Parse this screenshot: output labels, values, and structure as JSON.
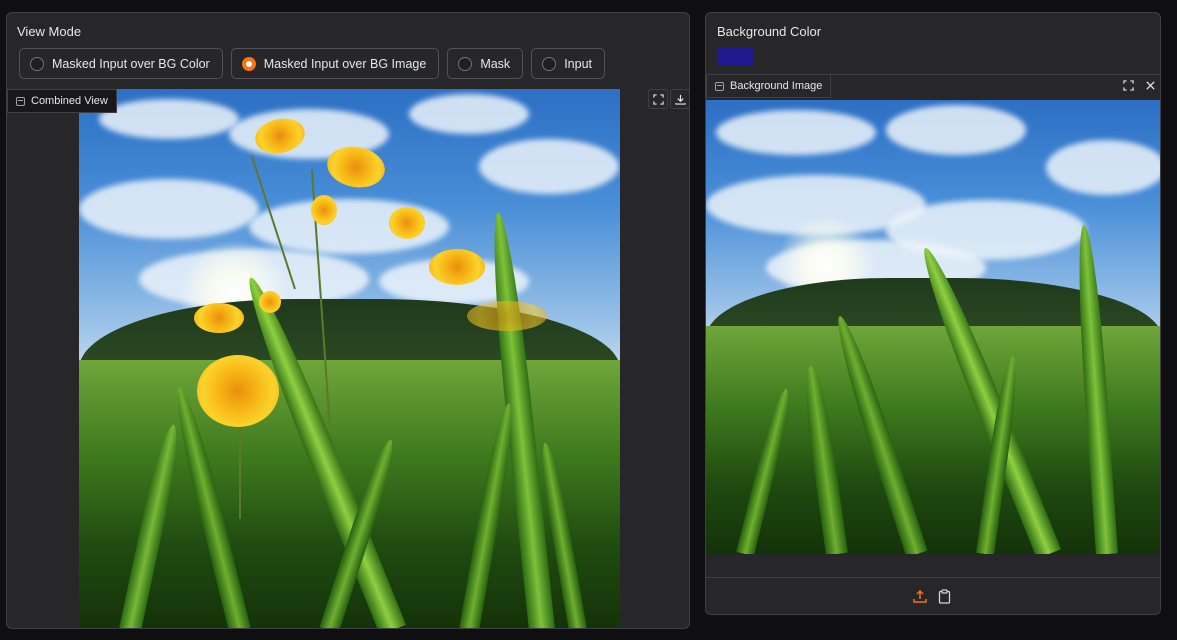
{
  "left_panel": {
    "title": "View Mode",
    "options": [
      {
        "label": "Masked Input over BG Color",
        "selected": false
      },
      {
        "label": "Masked Input over BG Image",
        "selected": true
      },
      {
        "label": "Mask",
        "selected": false
      },
      {
        "label": "Input",
        "selected": false
      }
    ],
    "image_label": "Combined View"
  },
  "right_panel": {
    "title": "Background Color",
    "color_value": "#1f1a8f",
    "image_label": "Background Image"
  },
  "colors": {
    "accent": "#f97316",
    "panel_bg": "#27272a",
    "page_bg": "#0f0f11"
  },
  "icons": {
    "fullscreen": "fullscreen-icon",
    "download": "download-icon",
    "close": "close-icon",
    "upload": "upload-icon",
    "clipboard": "clipboard-icon",
    "image": "image-icon"
  }
}
